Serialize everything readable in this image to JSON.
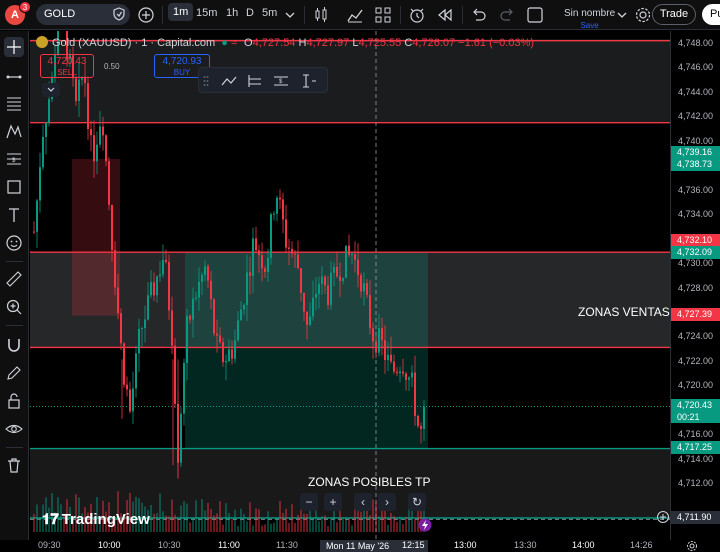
{
  "topbar": {
    "avatar_letter": "A",
    "notification_count": "3",
    "symbol": "GOLD",
    "timeframes": [
      "1m",
      "15m",
      "1h",
      "D",
      "5m"
    ],
    "active_timeframe": "1m",
    "save_title": "Sin nombre",
    "save_sub": "Save",
    "trade_label": "Trade",
    "publish_label": "Pu"
  },
  "legend": {
    "title": "Gold (XAUUSD) · 1 · Capital.com",
    "o_label": "O",
    "o_val": "4,727.54",
    "h_label": "H",
    "h_val": "4,727.97",
    "l_label": "L",
    "l_val": "4,725.55",
    "c_label": "C",
    "c_val": "4,726.07",
    "change": "−1.61 (−0.03%)"
  },
  "trade_panel": {
    "sell_price": "4,720.43",
    "sell_label": "SELL",
    "spread": "0.50",
    "buy_price": "4,720.93",
    "buy_label": "BUY"
  },
  "annotations": {
    "sell_zone": "ZONAS VENTAS",
    "tp_zone": "ZONAS POSIBLES TP"
  },
  "price_axis": {
    "ticks": [
      "4,748.00",
      "4,746.00",
      "4,744.00",
      "4,742.00",
      "4,740.00",
      "4,738.00",
      "4,736.00",
      "4,734.00",
      "4,732.00",
      "4,730.00",
      "4,728.00",
      "4,726.00",
      "4,724.00",
      "4,722.00",
      "4,720.00",
      "4,718.00",
      "4,716.00",
      "4,714.00",
      "4,712.00"
    ],
    "tags": {
      "p1": "4,739.16",
      "p2": "4,738.73",
      "p3": "4,732.10",
      "p4": "4,732.09",
      "p5": "4,727.39",
      "p6": "4,720.43",
      "p6_timer": "00:21",
      "p7": "4,717.25",
      "p8": "4,711.90"
    }
  },
  "time_axis": {
    "labels": [
      "09:30",
      "10:00",
      "10:30",
      "11:00",
      "11:30",
      "12:15",
      "13:00",
      "13:30",
      "14:00",
      "14:26"
    ],
    "crosshair": "Mon 11 May '26"
  },
  "branding": "TradingView",
  "colors": {
    "up": "#089981",
    "down": "#f23645",
    "sell_zone_line": "#f23645",
    "tp_zone_line": "#089981",
    "accent": "#2962ff"
  }
}
